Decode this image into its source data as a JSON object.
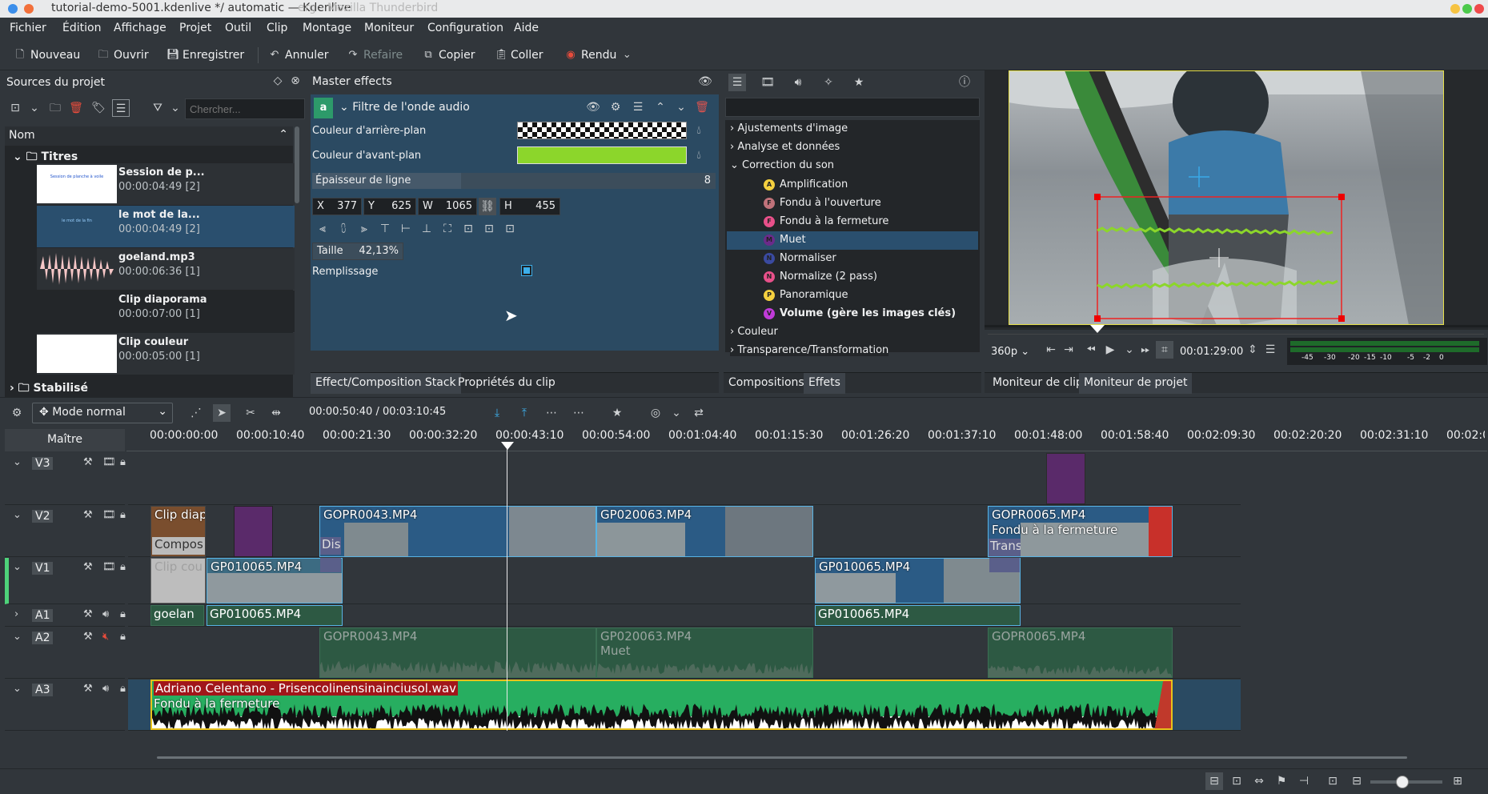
{
  "window": {
    "title": "tutorial-demo-5001.kdenlive */ automatic — Kdenlive",
    "ghost_title": "erg - Mozilla Thunderbird"
  },
  "menu": [
    "Fichier",
    "Édition",
    "Affichage",
    "Projet",
    "Outil",
    "Clip",
    "Montage",
    "Moniteur",
    "Configuration",
    "Aide"
  ],
  "toolbar": {
    "new": "Nouveau",
    "open": "Ouvrir",
    "save": "Enregistrer",
    "undo": "Annuler",
    "redo": "Refaire",
    "copy": "Copier",
    "paste": "Coller",
    "render": "Rendu"
  },
  "bin": {
    "title": "Sources du projet",
    "search_placeholder": "Chercher...",
    "col_name": "Nom",
    "folder1": "Titres",
    "folder2": "Stabilisé",
    "items": [
      {
        "name": "Session de p...",
        "dur": "00:00:04:49 [2]",
        "thumb_text": "Session de planche à voile"
      },
      {
        "name": "le mot de la...",
        "dur": "00:00:04:49 [2]",
        "thumb_text": "le mot de la fin"
      },
      {
        "name": "goeland.mp3",
        "dur": "00:00:06:36 [1]"
      },
      {
        "name": "Clip diaporama",
        "dur": "00:00:07:00 [1]"
      },
      {
        "name": "Clip couleur",
        "dur": "00:00:05:00 [1]"
      }
    ]
  },
  "effects_panel": {
    "title": "Master effects",
    "badge": "a",
    "effect": "Filtre de l'onde audio",
    "bg_label": "Couleur d'arrière-plan",
    "fg_label": "Couleur d'avant-plan",
    "fg_color": "#8cd62b",
    "line_label": "Épaisseur de ligne",
    "line_value": "8",
    "x_label": "X",
    "x": "377",
    "y_label": "Y",
    "y": "625",
    "w_label": "W",
    "w": "1065",
    "h_label": "H",
    "h": "455",
    "size_label": "Taille",
    "size": "42,13%",
    "fill_label": "Remplissage",
    "tab1": "Effect/Composition Stack",
    "tab2": "Propriétés du clip"
  },
  "effect_list": {
    "groups": [
      "Ajustements d'image",
      "Analyse et données",
      "Correction du son"
    ],
    "items": [
      {
        "b": "A",
        "name": "Amplification",
        "c": "#f4d03f"
      },
      {
        "b": "F",
        "name": "Fondu à l'ouverture",
        "c": "#c0727a"
      },
      {
        "b": "F",
        "name": "Fondu à la fermeture",
        "c": "#e8508a"
      },
      {
        "b": "M",
        "name": "Muet",
        "c": "#6b2b8a"
      },
      {
        "b": "N",
        "name": "Normaliser",
        "c": "#3a4aa0"
      },
      {
        "b": "N",
        "name": "Normalize (2 pass)",
        "c": "#e8508a"
      },
      {
        "b": "P",
        "name": "Panoramique",
        "c": "#f4d03f"
      },
      {
        "b": "V",
        "name": "Volume (gère les images clés)",
        "c": "#c03bd8"
      }
    ],
    "groups2": [
      "Couleur",
      "Transparence/Transformation"
    ],
    "tab1": "Compositions",
    "tab2": "Effets"
  },
  "monitor": {
    "zoom": "360p",
    "timecode": "00:01:29:00",
    "tab1": "Moniteur de clip",
    "tab2": "Moniteur de projet",
    "vu": [
      "-45",
      "-30",
      "-20",
      "-15",
      "-10",
      "-5",
      "-2",
      "0"
    ]
  },
  "timeline": {
    "mode": "Mode normal",
    "position": "00:00:50:40 / 00:03:10:45",
    "master": "Maître",
    "ruler": [
      "00:00:00:00",
      "00:00:10:40",
      "00:00:21:30",
      "00:00:32:20",
      "00:00:43:10",
      "00:00:54:00",
      "00:01:04:40",
      "00:01:15:30",
      "00:01:26:20",
      "00:01:37:10",
      "00:01:48:00",
      "00:01:58:40",
      "00:02:09:30",
      "00:02:20:20",
      "00:02:31:10",
      "00:02:0"
    ],
    "tracks": [
      "V3",
      "V2",
      "V1",
      "A1",
      "A2",
      "A3"
    ],
    "clips": {
      "v2a": "Clip diap",
      "v2a2": "Compos",
      "v2b": "GOPR0043.MP4",
      "v2b2": "Dis",
      "v2c": "GP020063.MP4",
      "v2d": "GOPR0065.MP4",
      "v2d2": "Fondu à la fermeture",
      "v2d3": "Trans",
      "v1a": "Clip cou",
      "v1b": "GP010065.MP4",
      "v1c": "GP010065.MP4",
      "a1a": "goelan",
      "a1b": "GP010065.MP4",
      "a1c": "GP010065.MP4",
      "a2a": "GOPR0043.MP4",
      "a2b": "GP020063.MP4",
      "a2b2": "Muet",
      "a2c": "GOPR0065.MP4",
      "a3": "Adriano Celentano - Prisencolinensinainciusol.wav",
      "a3b": "Fondu à la fermeture"
    }
  }
}
